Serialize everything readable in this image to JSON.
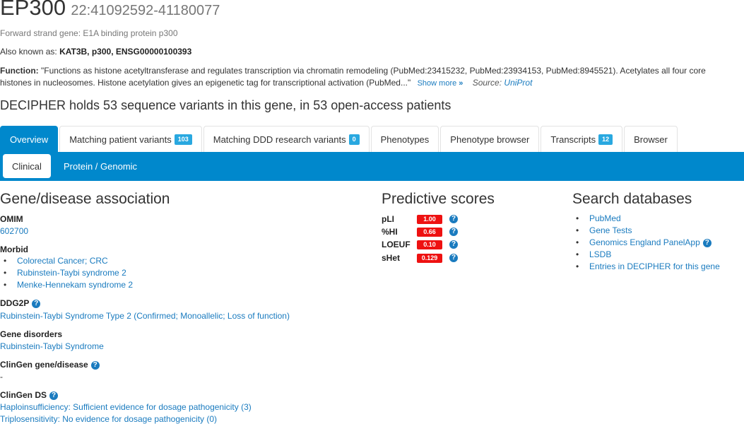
{
  "gene": {
    "symbol": "EP300",
    "coords": "22:41092592-41180077",
    "strand_text": "Forward strand gene: E1A binding protein p300",
    "aka_label": "Also known as:",
    "aka_value": "KAT3B, p300, ENSG00000100393",
    "function_label": "Function:",
    "function_line1": "\"Functions as histone acetyltransferase and regulates transcription via chromatin remodeling (PubMed:23415232, PubMed:23934153, PubMed:8945521). Acetylates all four core",
    "function_line2": "histones in nucleosomes. Histone acetylation gives an epigenetic tag for transcriptional activation (PubMed...\"",
    "show_more": "Show more",
    "show_more_icon": "»",
    "source_label": "Source:",
    "source_link": "UniProt",
    "summary": "DECIPHER holds 53 sequence variants in this gene, in 53 open-access patients"
  },
  "tabs": [
    {
      "label": "Overview",
      "badge": null,
      "active": true
    },
    {
      "label": "Matching patient variants",
      "badge": "103"
    },
    {
      "label": "Matching DDD research variants",
      "badge": "0"
    },
    {
      "label": "Phenotypes",
      "badge": null
    },
    {
      "label": "Phenotype browser",
      "badge": null
    },
    {
      "label": "Transcripts",
      "badge": "12"
    },
    {
      "label": "Browser",
      "badge": null
    }
  ],
  "subtabs": [
    {
      "label": "Clinical",
      "active": true
    },
    {
      "label": "Protein / Genomic"
    }
  ],
  "gene_disease": {
    "title": "Gene/disease association",
    "omim_label": "OMIM",
    "omim_value": "602700",
    "morbid_label": "Morbid",
    "morbid_items": [
      "Colorectal Cancer; CRC",
      "Rubinstein-Taybi syndrome 2",
      "Menke-Hennekam syndrome 2"
    ],
    "ddg2p_label": "DDG2P",
    "ddg2p_value": "Rubinstein-Taybi Syndrome Type 2 (Confirmed; Monoallelic; Loss of function)",
    "gene_disorders_label": "Gene disorders",
    "gene_disorders_value": "Rubinstein-Taybi Syndrome",
    "clingen_gd_label": "ClinGen gene/disease",
    "clingen_gd_value": "-",
    "clingen_ds_label": "ClinGen DS",
    "clingen_ds_hi": "Haploinsufficiency: Sufficient evidence for dosage pathogenicity (3)",
    "clingen_ds_ts": "Triplosensitivity: No evidence for dosage pathogenicity (0)"
  },
  "predictive": {
    "title": "Predictive scores",
    "scores": [
      {
        "name": "pLI",
        "value": "1.00"
      },
      {
        "name": "%HI",
        "value": "0.66"
      },
      {
        "name": "LOEUF",
        "value": "0.10"
      },
      {
        "name": "sHet",
        "value": "0.129"
      }
    ],
    "score_color": "#ee1111"
  },
  "search": {
    "title": "Search databases",
    "links": [
      "PubMed",
      "Gene Tests",
      "Genomics England PanelApp",
      "LSDB",
      "Entries in DECIPHER for this gene"
    ]
  },
  "icons": {
    "help": "?"
  },
  "colors": {
    "accent": "#0088cc",
    "badge": "#29a8e0",
    "link": "#1a7bbf"
  }
}
